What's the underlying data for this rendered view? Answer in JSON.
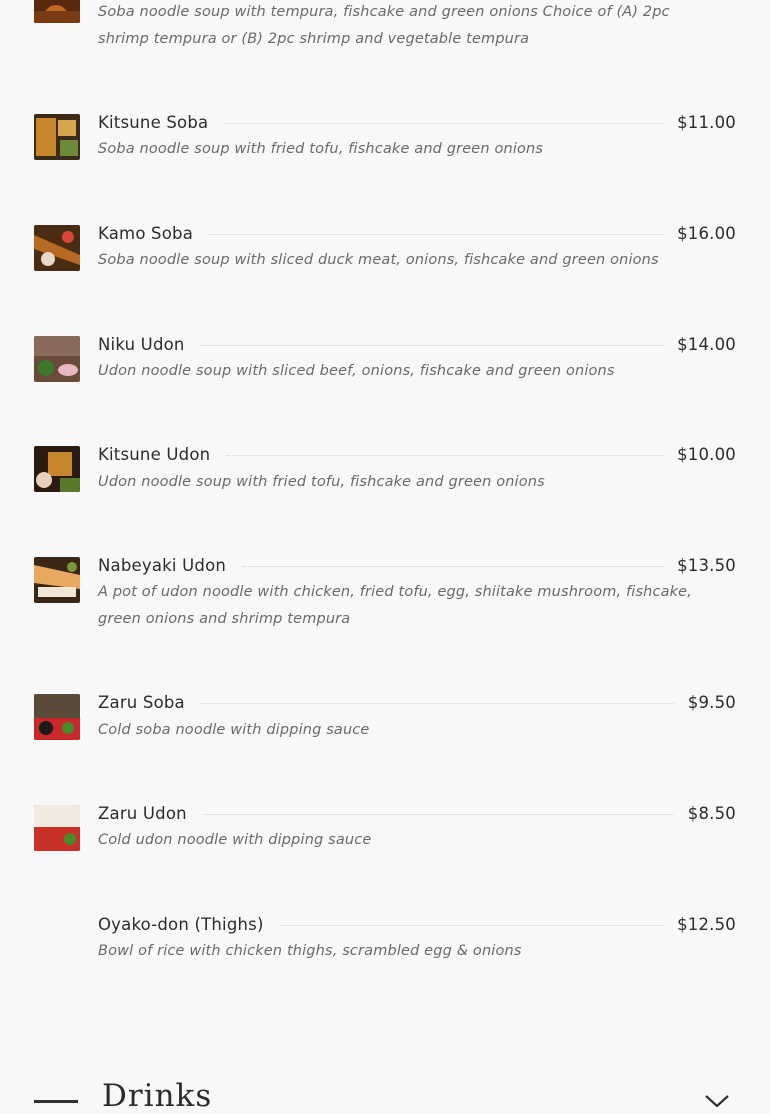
{
  "items": [
    {
      "name": "",
      "price": "",
      "desc": "Soba noodle soup with tempura, fishcake and green onions Choice of (A) 2pc shrimp tempura or (B) 2pc shrimp and vegetable tempura",
      "image": "tempura-soba-photo"
    },
    {
      "name": "Kitsune Soba",
      "price": "$11.00",
      "desc": "Soba noodle soup with fried tofu, fishcake and green onions",
      "image": "kitsune-soba-photo"
    },
    {
      "name": "Kamo Soba",
      "price": "$16.00",
      "desc": "Soba noodle soup with sliced duck meat, onions, fishcake and green onions",
      "image": "kamo-soba-photo"
    },
    {
      "name": "Niku Udon",
      "price": "$14.00",
      "desc": "Udon noodle soup with sliced beef, onions, fishcake and green onions",
      "image": "niku-udon-photo"
    },
    {
      "name": "Kitsune Udon",
      "price": "$10.00",
      "desc": "Udon noodle soup with fried tofu, fishcake and green onions",
      "image": "kitsune-udon-photo"
    },
    {
      "name": "Nabeyaki Udon",
      "price": "$13.50",
      "desc": "A pot of udon noodle with chicken, fried tofu, egg, shiitake mushroom, fishcake, green onions and shrimp tempura",
      "image": "nabeyaki-udon-photo"
    },
    {
      "name": "Zaru Soba",
      "price": "$9.50",
      "desc": "Cold soba noodle with dipping sauce",
      "image": "zaru-soba-photo"
    },
    {
      "name": "Zaru Udon",
      "price": "$8.50",
      "desc": "Cold udon noodle with dipping sauce",
      "image": "zaru-udon-photo"
    },
    {
      "name": "Oyako-don (Thighs)",
      "price": "$12.50",
      "desc": "Bowl of rice with chicken thighs, scrambled egg & onions",
      "image": ""
    }
  ],
  "section": {
    "title": "Drinks",
    "toggle_icon": "chevron-down-icon"
  },
  "colors": {
    "background": "#f8f8f8",
    "text": "#2c2c2c",
    "description": "#6a6a6a",
    "leader": "#cfcfcf"
  }
}
